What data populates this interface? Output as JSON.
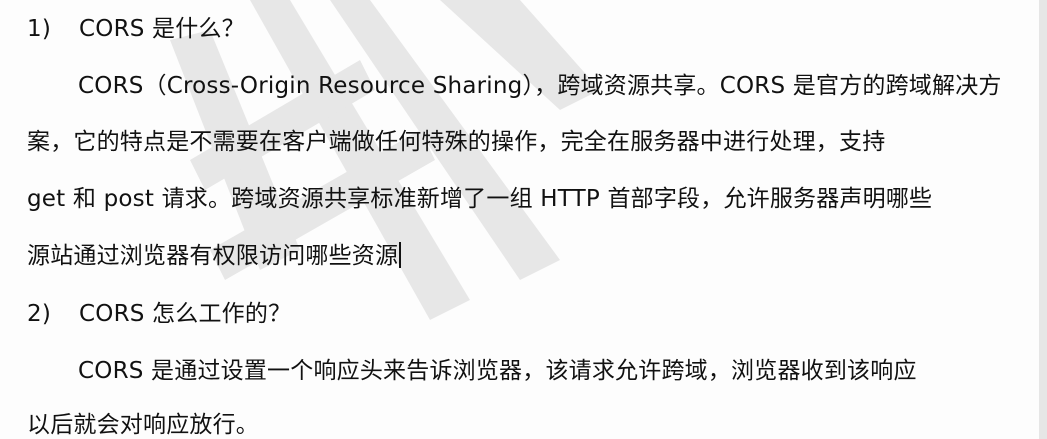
{
  "section1": {
    "number": "1)",
    "title": "CORS 是什么？",
    "lines": [
      "CORS（Cross-Origin Resource Sharing），跨域资源共享。CORS 是官方的跨域解决方",
      "案，它的特点是不需要在客户端做任何特殊的操作，完全在服务器中进行处理，支持",
      "get 和 post 请求。跨域资源共享标准新增了一组 HTTP  首部字段，允许服务器声明哪些",
      "源站通过浏览器有权限访问哪些资源"
    ]
  },
  "section2": {
    "number": "2)",
    "title": "CORS 怎么工作的？",
    "lines": [
      "CORS 是通过设置一个响应头来告诉浏览器，该请求允许跨域，浏览器收到该响应",
      "以后就会对响应放行。"
    ]
  }
}
